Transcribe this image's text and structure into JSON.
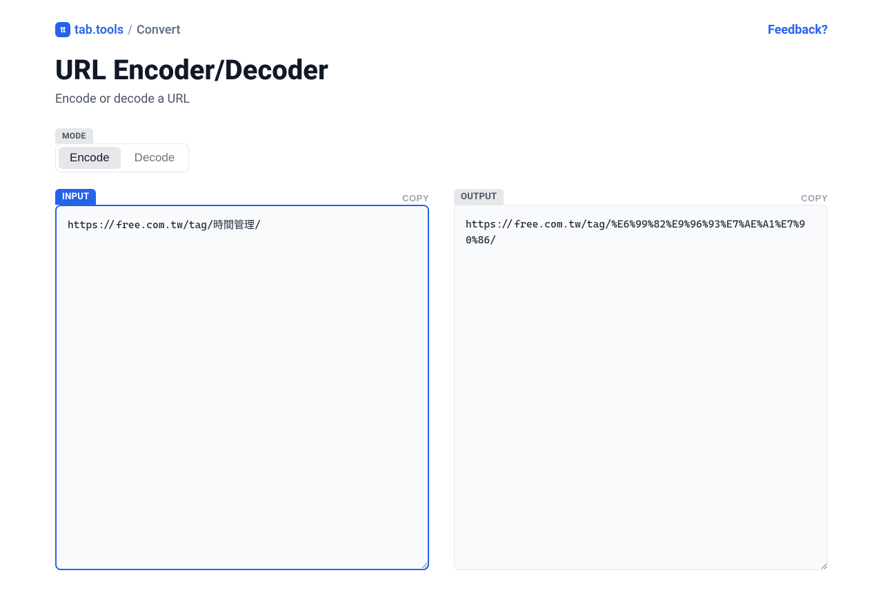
{
  "header": {
    "logo_text": "tt",
    "brand": "tab.tools",
    "separator": "/",
    "category": "Convert",
    "feedback": "Feedback?"
  },
  "page": {
    "title": "URL Encoder/Decoder",
    "subtitle": "Encode or decode a URL"
  },
  "mode": {
    "label": "MODE",
    "options": {
      "encode": "Encode",
      "decode": "Decode"
    },
    "active": "encode"
  },
  "input_panel": {
    "label": "INPUT",
    "copy": "COPY",
    "value": "https://free.com.tw/tag/時間管理/"
  },
  "output_panel": {
    "label": "OUTPUT",
    "copy": "COPY",
    "value": "https://free.com.tw/tag/%E6%99%82%E9%96%93%E7%AE%A1%E7%90%86/"
  }
}
